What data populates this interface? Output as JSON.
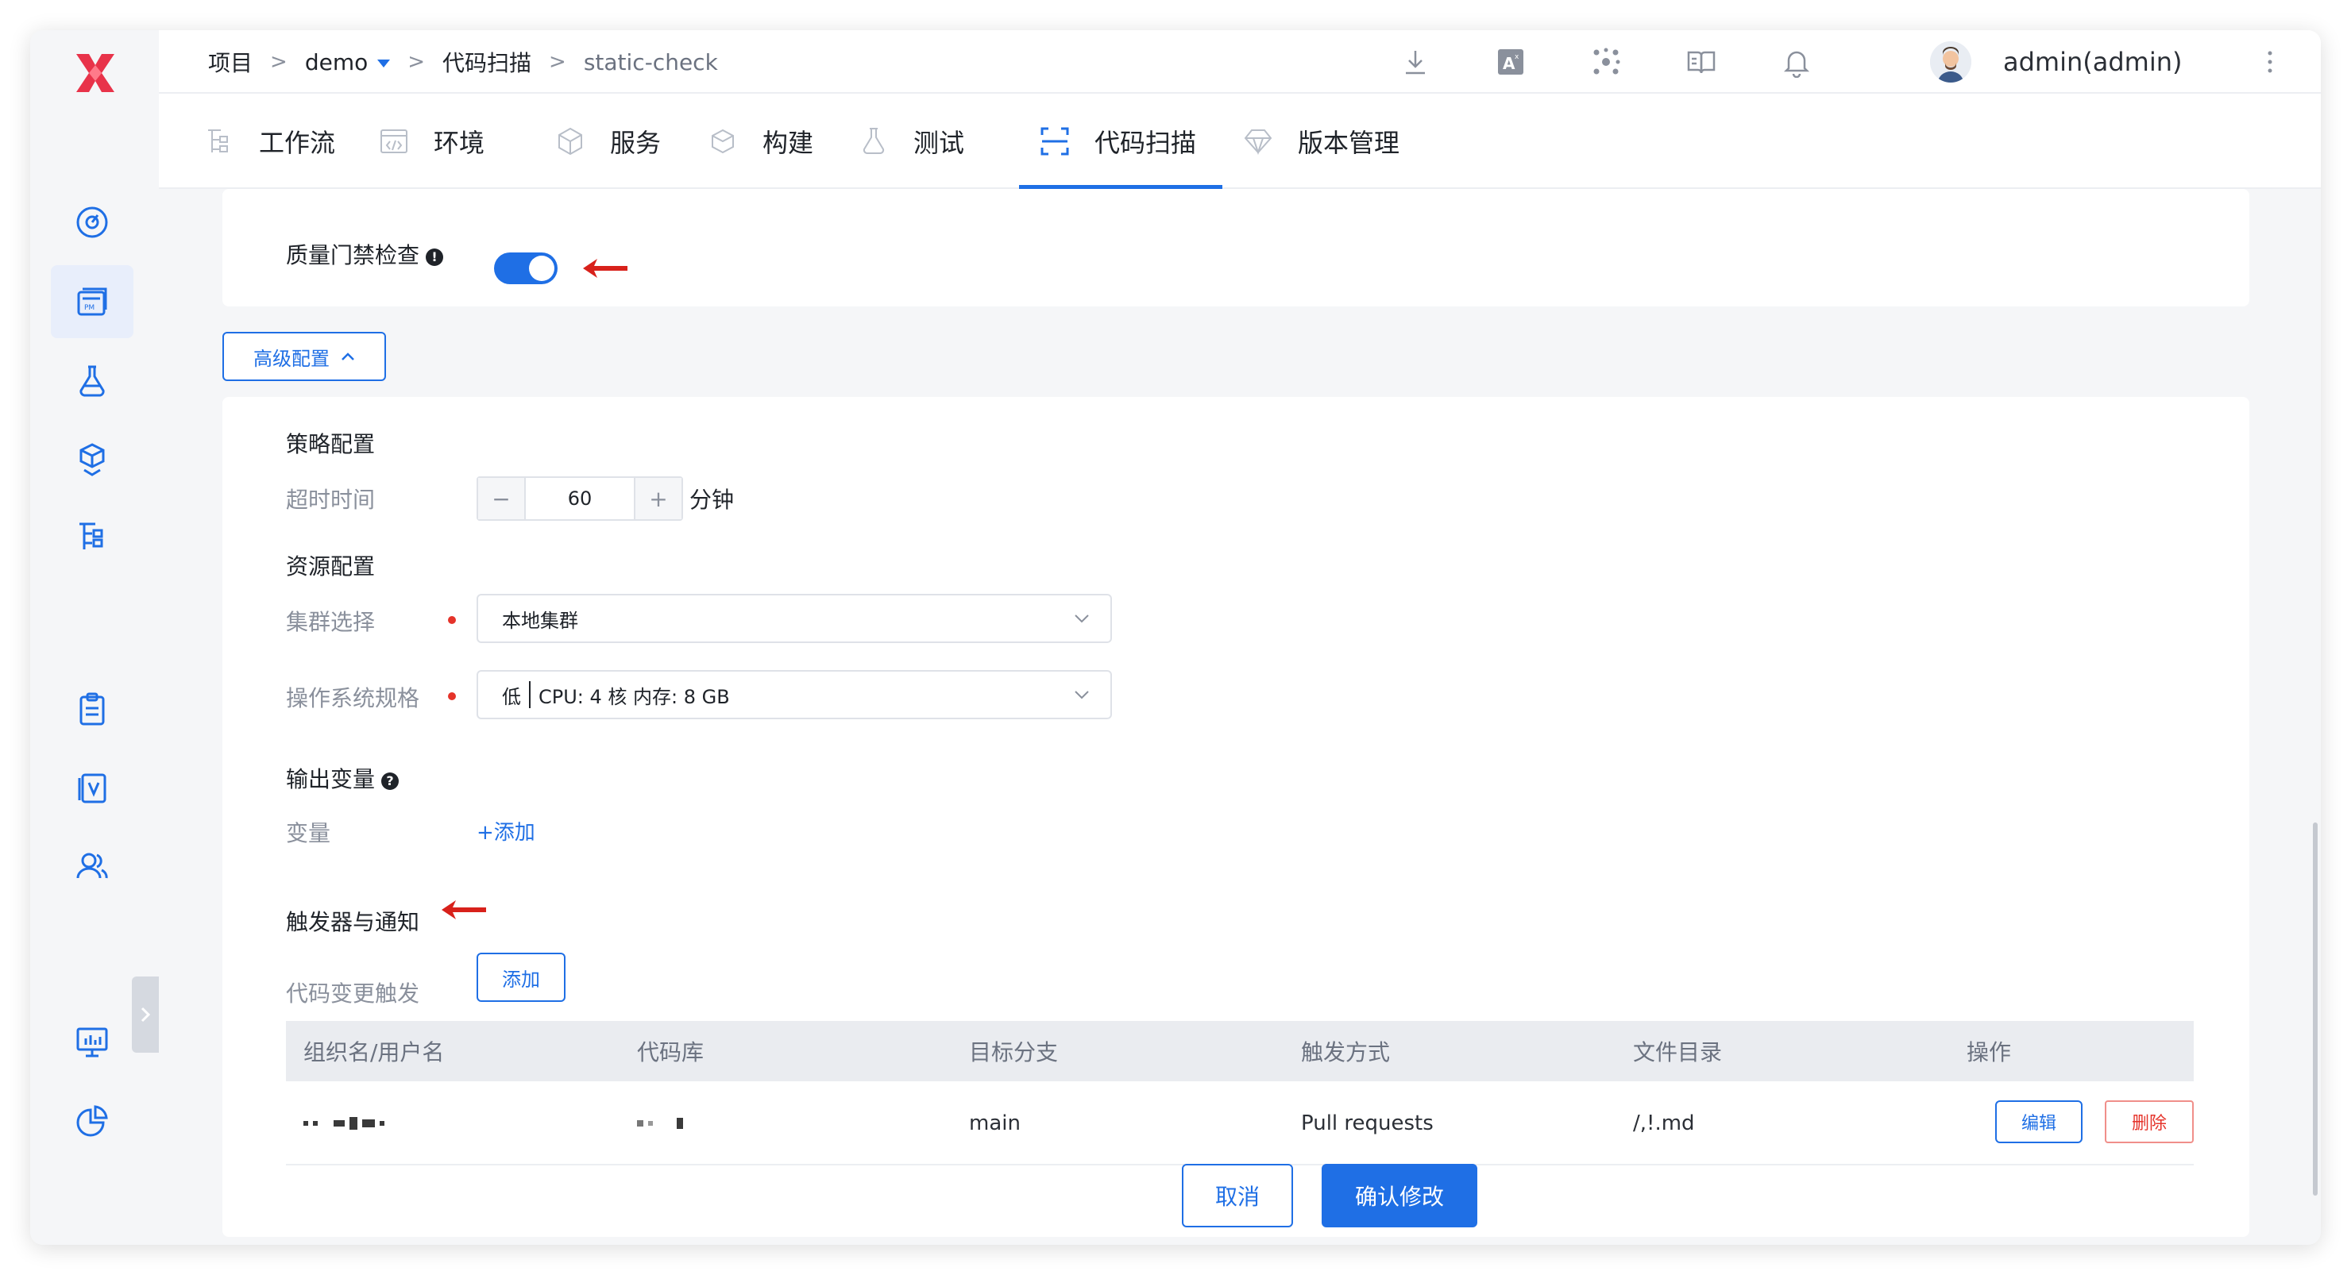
{
  "breadcrumb": {
    "root": "项目",
    "project": "demo",
    "section": "代码扫描",
    "current": "static-check",
    "separator": ">"
  },
  "user": {
    "name": "admin(admin)"
  },
  "tabs": [
    {
      "label": "工作流",
      "icon": "workflow-icon"
    },
    {
      "label": "环境",
      "icon": "code-env-icon"
    },
    {
      "label": "服务",
      "icon": "service-cube-icon"
    },
    {
      "label": "构建",
      "icon": "build-box-icon"
    },
    {
      "label": "测试",
      "icon": "flask-icon"
    },
    {
      "label": "代码扫描",
      "icon": "scan-icon",
      "active": true
    },
    {
      "label": "版本管理",
      "icon": "diamond-icon"
    }
  ],
  "quality_gate": {
    "label": "质量门禁检查",
    "info": "!",
    "enabled": true
  },
  "advanced_button": {
    "label": "高级配置"
  },
  "strategy": {
    "title": "策略配置",
    "timeout_label": "超时时间",
    "timeout_value": "60",
    "minus": "−",
    "plus": "+",
    "unit": "分钟"
  },
  "resource": {
    "title": "资源配置",
    "cluster_label": "集群选择",
    "cluster_value": "本地集群",
    "spec_label": "操作系统规格",
    "spec_level": "低",
    "spec_detail": "CPU: 4 核 内存: 8 GB"
  },
  "output_vars": {
    "title": "输出变量",
    "info": "?",
    "var_label": "变量",
    "add_link": "+添加"
  },
  "trigger": {
    "title": "触发器与通知",
    "code_change_label": "代码变更触发",
    "add_button": "添加",
    "columns": [
      "组织名/用户名",
      "代码库",
      "目标分支",
      "触发方式",
      "文件目录",
      "操作"
    ],
    "rows": [
      {
        "org": "",
        "repo": "",
        "branch": "main",
        "method": "Pull requests",
        "path": "/,!.md",
        "edit": "编辑",
        "delete": "删除"
      }
    ]
  },
  "footer": {
    "cancel": "取消",
    "confirm": "确认修改"
  },
  "colors": {
    "primary": "#1f6fe5",
    "danger": "#e5332a",
    "brand_logo": "#e8334a",
    "annotation_arrow": "#d8211b"
  }
}
